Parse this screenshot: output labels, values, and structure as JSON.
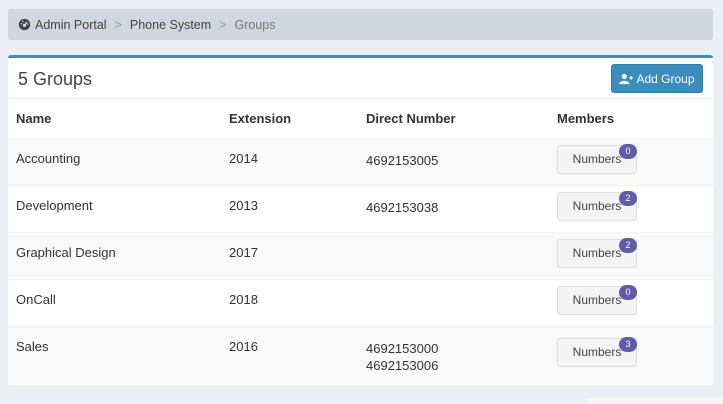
{
  "breadcrumb": {
    "items": [
      "Admin Portal",
      "Phone System",
      "Groups"
    ],
    "separator": ">",
    "icon": "dashboard-icon"
  },
  "box": {
    "title": "5 Groups",
    "add_button_label": "Add Group",
    "add_button_icon": "user-plus-icon",
    "accent_color": "#3c8dbc"
  },
  "table": {
    "headers": [
      "Name",
      "Extension",
      "Direct Number",
      "Members"
    ],
    "members_button_label": "Numbers",
    "badge_color": "#605ca8",
    "rows": [
      {
        "name": "Accounting",
        "extension": "2014",
        "direct_numbers": [
          "4692153005"
        ],
        "members_count": "0"
      },
      {
        "name": "Development",
        "extension": "2013",
        "direct_numbers": [
          "4692153038"
        ],
        "members_count": "2"
      },
      {
        "name": "Graphical Design",
        "extension": "2017",
        "direct_numbers": [],
        "members_count": "2"
      },
      {
        "name": "OnCall",
        "extension": "2018",
        "direct_numbers": [],
        "members_count": "0"
      },
      {
        "name": "Sales",
        "extension": "2016",
        "direct_numbers": [
          "4692153000",
          "4692153006"
        ],
        "members_count": "3"
      }
    ]
  }
}
